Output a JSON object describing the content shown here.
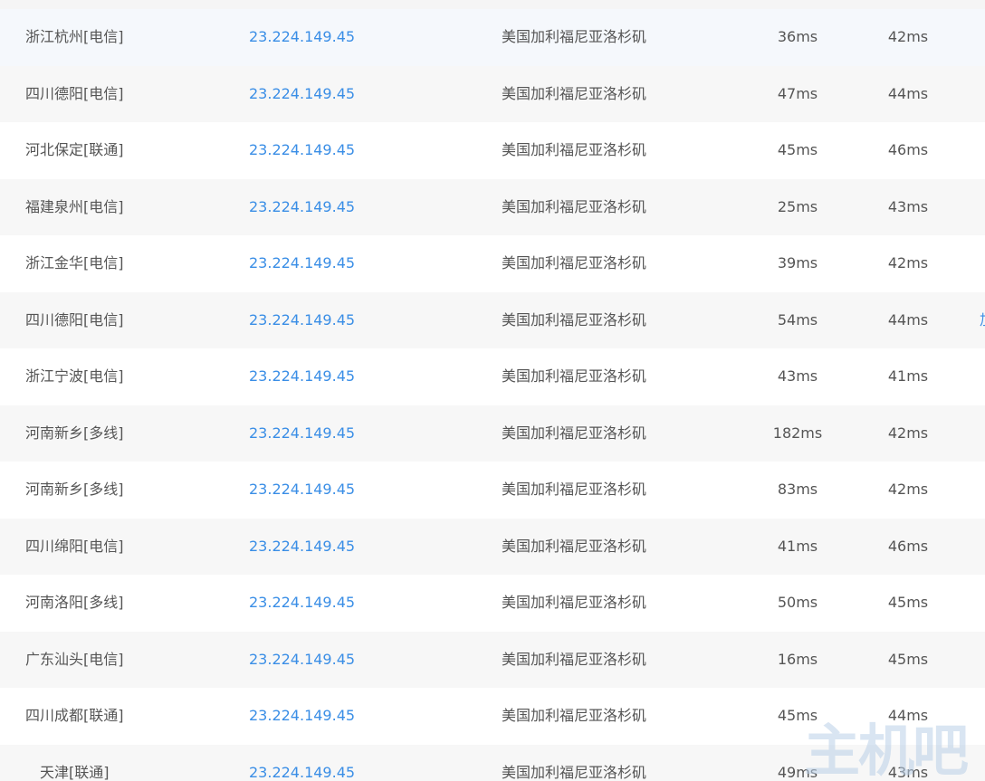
{
  "table": {
    "rows": [
      {
        "node": "浙江杭州[电信]",
        "ip": "23.224.149.45",
        "location": "美国加利福尼亚洛杉矶",
        "ping": "36ms",
        "avg": "42ms"
      },
      {
        "node": "四川德阳[电信]",
        "ip": "23.224.149.45",
        "location": "美国加利福尼亚洛杉矶",
        "ping": "47ms",
        "avg": "44ms"
      },
      {
        "node": "河北保定[联通]",
        "ip": "23.224.149.45",
        "location": "美国加利福尼亚洛杉矶",
        "ping": "45ms",
        "avg": "46ms"
      },
      {
        "node": "福建泉州[电信]",
        "ip": "23.224.149.45",
        "location": "美国加利福尼亚洛杉矶",
        "ping": "25ms",
        "avg": "43ms"
      },
      {
        "node": "浙江金华[电信]",
        "ip": "23.224.149.45",
        "location": "美国加利福尼亚洛杉矶",
        "ping": "39ms",
        "avg": "42ms"
      },
      {
        "node": "四川德阳[电信]",
        "ip": "23.224.149.45",
        "location": "美国加利福尼亚洛杉矶",
        "ping": "54ms",
        "avg": "44ms",
        "edge": "加"
      },
      {
        "node": "浙江宁波[电信]",
        "ip": "23.224.149.45",
        "location": "美国加利福尼亚洛杉矶",
        "ping": "43ms",
        "avg": "41ms"
      },
      {
        "node": "河南新乡[多线]",
        "ip": "23.224.149.45",
        "location": "美国加利福尼亚洛杉矶",
        "ping": "182ms",
        "avg": "42ms"
      },
      {
        "node": "河南新乡[多线]",
        "ip": "23.224.149.45",
        "location": "美国加利福尼亚洛杉矶",
        "ping": "83ms",
        "avg": "42ms"
      },
      {
        "node": "四川绵阳[电信]",
        "ip": "23.224.149.45",
        "location": "美国加利福尼亚洛杉矶",
        "ping": "41ms",
        "avg": "46ms"
      },
      {
        "node": "河南洛阳[多线]",
        "ip": "23.224.149.45",
        "location": "美国加利福尼亚洛杉矶",
        "ping": "50ms",
        "avg": "45ms"
      },
      {
        "node": "广东汕头[电信]",
        "ip": "23.224.149.45",
        "location": "美国加利福尼亚洛杉矶",
        "ping": "16ms",
        "avg": "45ms"
      },
      {
        "node": "四川成都[联通]",
        "ip": "23.224.149.45",
        "location": "美国加利福尼亚洛杉矶",
        "ping": "45ms",
        "avg": "44ms"
      },
      {
        "node": "天津[联通]",
        "ip": "23.224.149.45",
        "location": "美国加利福尼亚洛杉矶",
        "ping": "49ms",
        "avg": "43ms"
      }
    ]
  },
  "watermark": {
    "text": "主机吧"
  },
  "colors": {
    "link": "#3a8ee6",
    "text": "#555555",
    "stripe": "#f7f7f7",
    "hover_row": "#f5f8fc"
  }
}
